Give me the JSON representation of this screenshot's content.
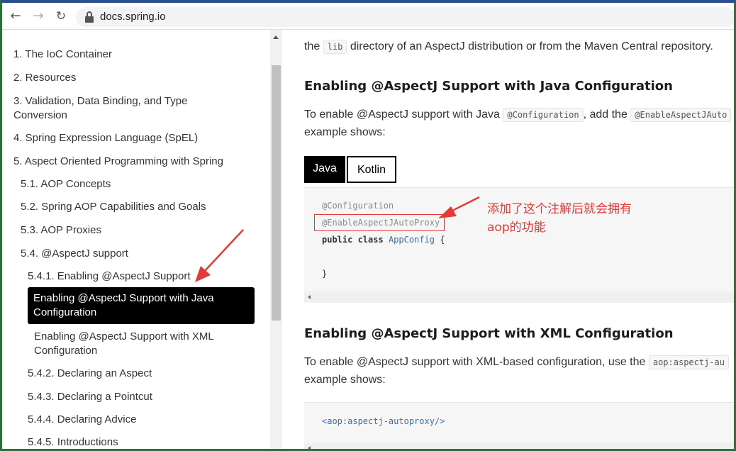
{
  "browser": {
    "back_icon": "arrow-left-icon",
    "forward_icon": "arrow-right-icon",
    "reload_icon": "reload-icon",
    "url": "docs.spring.io"
  },
  "sidebar": {
    "items": [
      {
        "label": "1. The IoC Container"
      },
      {
        "label": "2. Resources"
      },
      {
        "label": "3. Validation, Data Binding, and Type"
      },
      {
        "label": "Conversion"
      },
      {
        "label": "4. Spring Expression Language (SpEL)"
      },
      {
        "label": "5. Aspect Oriented Programming with Spring"
      },
      {
        "label": "5.1. AOP Concepts"
      },
      {
        "label": "5.2. Spring AOP Capabilities and Goals"
      },
      {
        "label": "5.3. AOP Proxies"
      },
      {
        "label": "5.4. @AspectJ support"
      },
      {
        "label": "5.4.1. Enabling @AspectJ Support"
      },
      {
        "label": "Enabling @AspectJ Support with Java"
      },
      {
        "label": "Configuration"
      },
      {
        "label": "Enabling @AspectJ Support with XML"
      },
      {
        "label": "Configuration"
      },
      {
        "label": "5.4.2. Declaring an Aspect"
      },
      {
        "label": "5.4.3. Declaring a Pointcut"
      },
      {
        "label": "5.4.4. Declaring Advice"
      },
      {
        "label": "5.4.5. Introductions"
      }
    ]
  },
  "main": {
    "intro": {
      "prefix": "the",
      "code": "lib",
      "suffix": "directory of an AspectJ distribution or from the Maven Central repository."
    },
    "java_section": {
      "heading": "Enabling @AspectJ Support with Java Configuration",
      "para_line1_prefix": "To enable @AspectJ support with Java",
      "para_code1": "@Configuration",
      "para_mid": ", add the",
      "para_code2": "@EnableAspectJAuto",
      "para_line2": "example shows:",
      "tabs": [
        "Java",
        "Kotlin"
      ],
      "code": {
        "line1": "@Configuration",
        "line2": "@EnableAspectJAutoProxy",
        "line3_kw": "public class",
        "line3_cls": "AppConfig",
        "line3_end": "{",
        "line4": "}"
      }
    },
    "xml_section": {
      "heading": "Enabling @AspectJ Support with XML Configuration",
      "para_line1_prefix": "To enable @AspectJ support with XML-based configuration, use the",
      "para_code": "aop:aspectj-au",
      "para_line2": "example shows:",
      "code": "<aop:aspectj-autoproxy/>"
    }
  },
  "annotation": {
    "line1": "添加了这个注解后就会拥有",
    "line2": "aop的功能",
    "color": "#e53935"
  }
}
